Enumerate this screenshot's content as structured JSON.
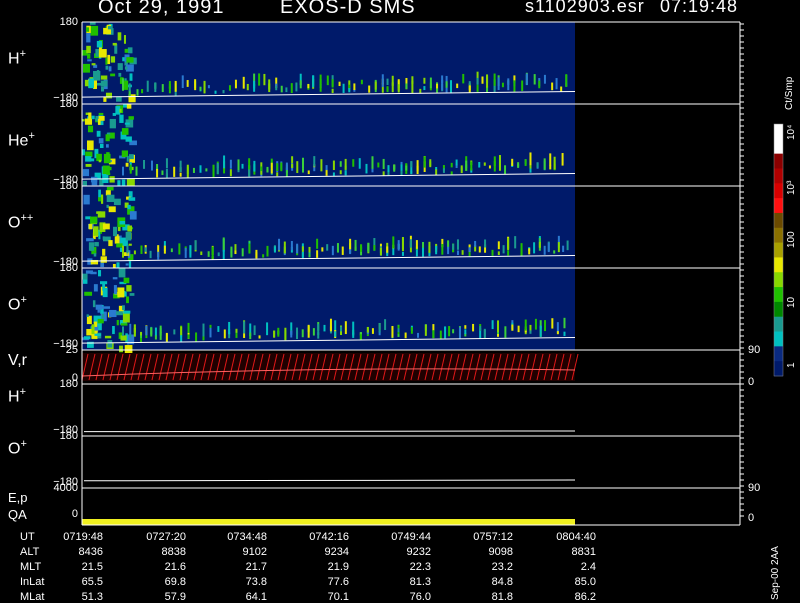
{
  "header": {
    "date": "Oct 29, 1991",
    "instrument": "EXOS-D SMS",
    "file": "s1102903.esr",
    "time": "07:19:48"
  },
  "panels": [
    {
      "label": "H",
      "sup": "+",
      "tick_top": "180",
      "tick_bottom": "−180"
    },
    {
      "label": "He",
      "sup": "+",
      "tick_top": "180",
      "tick_bottom": "−180"
    },
    {
      "label": "O",
      "sup": "++",
      "tick_top": "180",
      "tick_bottom": "−180"
    },
    {
      "label": "O",
      "sup": "+",
      "tick_top": "180",
      "tick_bottom": "−180"
    },
    {
      "label": "V,r",
      "sup": "",
      "tick_top": "25",
      "tick_bottom": "0",
      "right_top": "90",
      "right_bottom": "0"
    },
    {
      "label": "H",
      "sup": "+",
      "tick_top": "180",
      "tick_bottom": "−180"
    },
    {
      "label": "O",
      "sup": "+",
      "tick_top": "180",
      "tick_bottom": "−180"
    },
    {
      "label": "E,p",
      "sup": "",
      "tick_top": "4000",
      "tick_bottom": "0",
      "right_top": "90",
      "right_bottom": "0"
    }
  ],
  "qa_label": "QA",
  "colorbar": {
    "title": "Ct/Smp",
    "labels": [
      "10⁴",
      "10³",
      "100",
      "10",
      "1"
    ],
    "colors": [
      "#ffffff",
      "#ffffff",
      "#8b0000",
      "#b00000",
      "#d80000",
      "#ff1010",
      "#6b4a00",
      "#8a7000",
      "#a8a000",
      "#e8e800",
      "#88d800",
      "#20c000",
      "#008800",
      "#1a9a90",
      "#00c0c0",
      "#0a2a80",
      "#001a6a"
    ]
  },
  "table": {
    "rows": [
      {
        "name": "UT",
        "values": [
          "0719:48",
          "0727:20",
          "0734:48",
          "0742:16",
          "0749:44",
          "0757:12",
          "0804:40"
        ]
      },
      {
        "name": "ALT",
        "values": [
          "8436",
          "8838",
          "9102",
          "9234",
          "9232",
          "9098",
          "8831"
        ]
      },
      {
        "name": "MLT",
        "values": [
          "21.5",
          "21.6",
          "21.7",
          "21.9",
          "22.3",
          "23.2",
          "2.4"
        ]
      },
      {
        "name": "InLat",
        "values": [
          "65.5",
          "69.8",
          "73.8",
          "77.6",
          "81.3",
          "84.8",
          "85.0"
        ]
      },
      {
        "name": "MLat",
        "values": [
          "51.3",
          "57.9",
          "64.1",
          "70.1",
          "76.0",
          "81.8",
          "86.2"
        ]
      }
    ]
  },
  "footer_note": "Sep-00 2AA",
  "chart_data": {
    "type": "heatmap",
    "title": "Oct 29, 1991   EXOS-D SMS",
    "x_time_labels": [
      "0719:48",
      "0727:20",
      "0734:48",
      "0742:16",
      "0749:44",
      "0757:12",
      "0804:40"
    ],
    "data_end_fraction": 0.85,
    "color_scale": "log",
    "color_range": [
      1,
      10000
    ],
    "colorbar_unit": "Ct/Smp",
    "spectrogram_panels": [
      {
        "species": "H+",
        "ylim": [
          -180,
          180
        ],
        "trace_start": -150,
        "trace_end": -125
      },
      {
        "species": "He+",
        "ylim": [
          -180,
          180
        ],
        "trace_start": -150,
        "trace_end": -125
      },
      {
        "species": "O++",
        "ylim": [
          -180,
          180
        ],
        "trace_start": -150,
        "trace_end": -125
      },
      {
        "species": "O+",
        "ylim": [
          -180,
          180
        ],
        "trace_start": -150,
        "trace_end": -125
      }
    ],
    "line_panels": [
      {
        "label": "V,r",
        "ylim": [
          0,
          25
        ],
        "right_ylim": [
          0,
          90
        ]
      },
      {
        "label": "H+",
        "ylim": [
          -180,
          180
        ],
        "trace_start": -150,
        "trace_end": -145
      },
      {
        "label": "O+",
        "ylim": [
          -180,
          180
        ],
        "trace_start": -130,
        "trace_end": -125
      },
      {
        "label": "E,p",
        "ylim": [
          0,
          4000
        ],
        "right_ylim": [
          0,
          90
        ]
      }
    ]
  }
}
